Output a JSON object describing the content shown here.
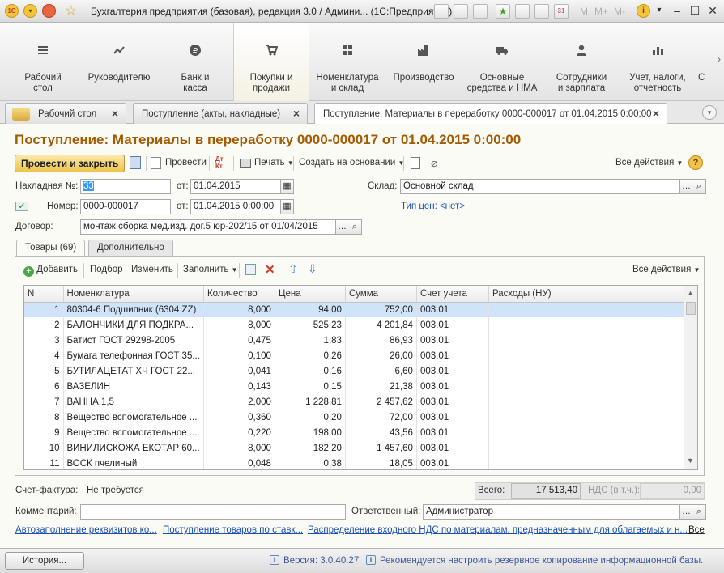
{
  "window": {
    "title": "Бухгалтерия предприятия (базовая), редакция 3.0 / Админи...  (1С:Предприятие)",
    "toolbar_text": [
      "M",
      "M+",
      "M-"
    ]
  },
  "sections": [
    {
      "label": "Рабочий\nстол",
      "icon": "menu-icon"
    },
    {
      "label": "Руководителю",
      "icon": "trend-icon"
    },
    {
      "label": "Банк и\nкасса",
      "icon": "ruble-icon"
    },
    {
      "label": "Покупки и\nпродажи",
      "icon": "cart-icon"
    },
    {
      "label": "Номенклатура\nи склад",
      "icon": "grid-icon"
    },
    {
      "label": "Производство",
      "icon": "factory-icon"
    },
    {
      "label": "Основные\nсредства и НМА",
      "icon": "truck-icon"
    },
    {
      "label": "Сотрудники\nи зарплата",
      "icon": "person-icon"
    },
    {
      "label": "Учет, налоги,\nотчетность",
      "icon": "bars-icon"
    },
    {
      "label": "С",
      "icon": "menu-icon"
    }
  ],
  "tabs": [
    {
      "label": "Рабочий стол"
    },
    {
      "label": "Поступление (акты, накладные)"
    },
    {
      "label": "Поступление: Материалы в переработку 0000-000017 от 01.04.2015 0:00:00"
    }
  ],
  "doc_title": "Поступление: Материалы в переработку 0000-000017 от 01.04.2015 0:00:00",
  "cmd": {
    "post_close": "Провести и закрыть",
    "post": "Провести",
    "print": "Печать",
    "create_based": "Создать на основании",
    "all_actions": "Все действия",
    "help": "?"
  },
  "fields": {
    "invoice_label": "Накладная  №:",
    "invoice_value": "33",
    "from_label": "от:",
    "invoice_date": "01.04.2015",
    "warehouse_label": "Склад:",
    "warehouse_value": "Основной склад",
    "number_label": "Номер:",
    "number_value": "0000-000017",
    "number_date": "01.04.2015  0:00:00",
    "price_type_link": "Тип цен: <нет>",
    "contract_label": "Договор:",
    "contract_value": "монтаж,сборка мед.изд. дог.5 юр-202/15 от 01/04/2015"
  },
  "inner_tabs": [
    {
      "label": "Товары (69)"
    },
    {
      "label": "Дополнительно"
    }
  ],
  "table_cmd": {
    "add": "Добавить",
    "pick": "Подбор",
    "edit": "Изменить",
    "fill": "Заполнить",
    "all_actions": "Все действия"
  },
  "table": {
    "columns": [
      "N",
      "Номенклатура",
      "Количество",
      "Цена",
      "Сумма",
      "Счет учета",
      "Расходы (НУ)"
    ],
    "rows": [
      [
        "1",
        "80304-6 Подшипник (6304 ZZ)",
        "8,000",
        "94,00",
        "752,00",
        "003.01",
        ""
      ],
      [
        "2",
        "БАЛОНЧИКИ ДЛЯ ПОДКРА...",
        "8,000",
        "525,23",
        "4 201,84",
        "003.01",
        ""
      ],
      [
        "3",
        "Батист ГОСТ 29298-2005",
        "0,475",
        "1,83",
        "86,93",
        "003.01",
        ""
      ],
      [
        "4",
        "Бумага телефонная ГОСТ 35...",
        "0,100",
        "0,26",
        "26,00",
        "003.01",
        ""
      ],
      [
        "5",
        "БУТИЛАЦЕТАТ ХЧ ГОСТ 22...",
        "0,041",
        "0,16",
        "6,60",
        "003.01",
        ""
      ],
      [
        "6",
        "ВАЗЕЛИН",
        "0,143",
        "0,15",
        "21,38",
        "003.01",
        ""
      ],
      [
        "7",
        "ВАННА 1,5",
        "2,000",
        "1 228,81",
        "2 457,62",
        "003.01",
        ""
      ],
      [
        "8",
        "Вещество вспомогательное ...",
        "0,360",
        "0,20",
        "72,00",
        "003.01",
        ""
      ],
      [
        "9",
        "Вещество вспомогательное ...",
        "0,220",
        "198,00",
        "43,56",
        "003.01",
        ""
      ],
      [
        "10",
        "ВИНИЛИСКОЖА ЕКОТАР 60...",
        "8,000",
        "182,20",
        "1 457,60",
        "003.01",
        ""
      ],
      [
        "11",
        "ВОСК пчелиный",
        "0,048",
        "0,38",
        "18,05",
        "003.01",
        ""
      ]
    ]
  },
  "footer": {
    "invoice_label": "Счет-фактура:",
    "invoice_value": "Не требуется",
    "total_label": "Всего:",
    "total_value": "17 513,40",
    "vat_label": "НДС (в т.ч.):",
    "vat_value": "0,00",
    "comment_label": "Комментарий:",
    "comment_value": "",
    "responsible_label": "Ответственный:",
    "responsible_value": "Администратор",
    "links": [
      "Автозаполнение реквизитов ко...",
      "Поступление товаров по ставк...",
      "Распределение входного НДС по материалам, предназначенным для облагаемых и н...",
      "Все"
    ]
  },
  "status": {
    "history_button": "История...",
    "version": "Версия: 3.0.40.27",
    "backup_notice": "Рекомендуется настроить резервное копирование информационной базы."
  },
  "colors": {
    "title_accent": "#a45a00",
    "primary_button": "#eec44e",
    "selected_row": "#cfe3f9",
    "link": "#1b4fb8"
  }
}
